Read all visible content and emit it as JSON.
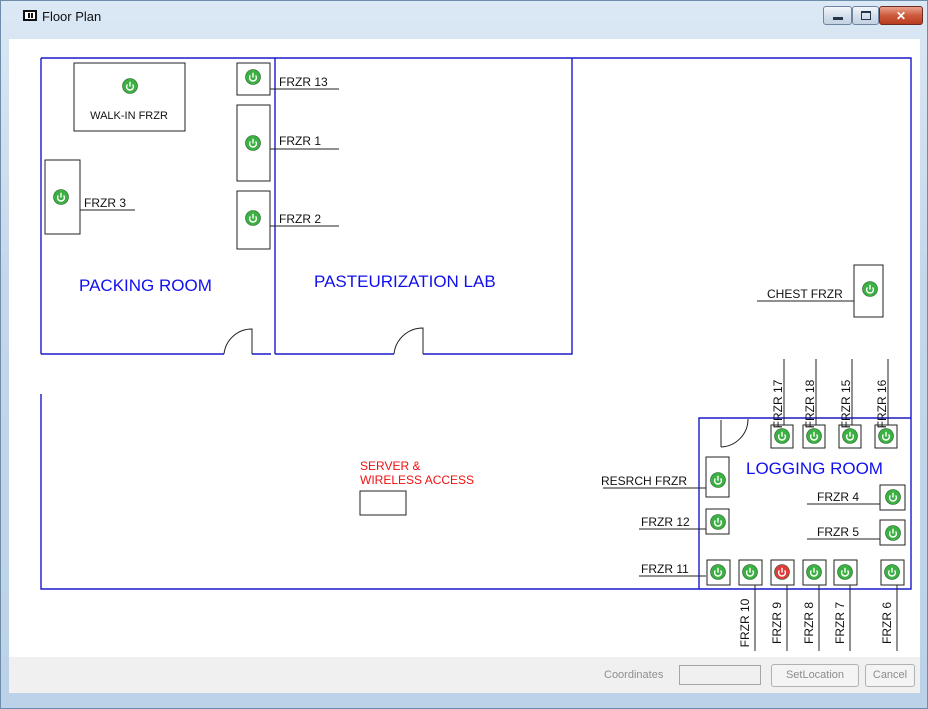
{
  "window": {
    "title": "Floor Plan",
    "controls": {
      "minimize": "",
      "maximize": "",
      "close": "✕"
    }
  },
  "rooms": {
    "packing": "PACKING ROOM",
    "pasteurization": "PASTEURIZATION LAB",
    "logging": "LOGGING ROOM"
  },
  "server": {
    "line1": "SERVER &",
    "line2": "WIRELESS ACCESS"
  },
  "freezers": {
    "walkin": {
      "label": "WALK-IN FRZR",
      "status": "on"
    },
    "frzr13": {
      "label": "FRZR 13",
      "status": "on"
    },
    "frzr1": {
      "label": "FRZR 1",
      "status": "on"
    },
    "frzr2": {
      "label": "FRZR 2",
      "status": "on"
    },
    "frzr3": {
      "label": "FRZR 3",
      "status": "on"
    },
    "chest": {
      "label": "CHEST FRZR",
      "status": "on"
    },
    "frzr17": {
      "label": "FRZR 17",
      "status": "on"
    },
    "frzr18": {
      "label": "FRZR 18",
      "status": "on"
    },
    "frzr15": {
      "label": "FRZR 15",
      "status": "on"
    },
    "frzr16": {
      "label": "FRZR 16",
      "status": "on"
    },
    "resrch": {
      "label": "RESRCH FRZR",
      "status": "on"
    },
    "frzr12": {
      "label": "FRZR 12",
      "status": "on"
    },
    "frzr11": {
      "label": "FRZR 11",
      "status": "on"
    },
    "frzr4": {
      "label": "FRZR 4",
      "status": "on"
    },
    "frzr5": {
      "label": "FRZR 5",
      "status": "on"
    },
    "frzr10": {
      "label": "FRZR 10",
      "status": "on"
    },
    "frzr9": {
      "label": "FRZR 9",
      "status": "off"
    },
    "frzr8": {
      "label": "FRZR 8",
      "status": "on"
    },
    "frzr7": {
      "label": "FRZR 7",
      "status": "on"
    },
    "frzr6": {
      "label": "FRZR 6",
      "status": "on"
    }
  },
  "colors": {
    "wall": "#1a1acc",
    "room_label": "#1010ee",
    "server_label": "#ee1111",
    "status_on": "#3cb043",
    "status_off": "#e03a3a",
    "power_icon": "power-icon"
  },
  "footer": {
    "coordinates_label": "Coordinates",
    "coordinates_value": "",
    "setlocation_label": "SetLocation",
    "cancel_label": "Cancel"
  }
}
